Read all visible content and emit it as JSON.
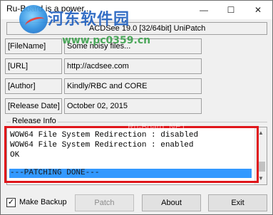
{
  "window": {
    "title": "Ru-Board is a power...",
    "minimize_glyph": "—",
    "maximize_glyph": "☐",
    "close_glyph": "✕"
  },
  "watermark": {
    "cn_text": "河东软件园",
    "url": "www.pc0359.cn",
    "ghost_text": "Ru-Board .NET"
  },
  "product_bar": {
    "text": "ACDSee 19.0 [32/64bit] UniPatch"
  },
  "info_rows": [
    {
      "label": "[FileName]",
      "value": "Some noisy files..."
    },
    {
      "label": "[URL]",
      "value": "http://acdsee.com"
    },
    {
      "label": "[Author]",
      "value": "Kindly/RBC and CORE"
    },
    {
      "label": "[Release Date]",
      "value": "October 02, 2015"
    }
  ],
  "release_info": {
    "label": "Release Info",
    "lines": [
      "WOW64 File System Redirection : disabled",
      "WOW64 File System Redirection : enabled",
      "OK"
    ],
    "selected_line": "---PATCHING DONE---",
    "scroll_up_glyph": "▲",
    "scroll_down_glyph": "▼"
  },
  "footer": {
    "make_backup_label": "Make Backup",
    "make_backup_checked": true,
    "check_glyph": "✓",
    "patch_label": "Patch",
    "about_label": "About",
    "exit_label": "Exit"
  },
  "colors": {
    "selection": "#3399ff",
    "highlight_border": "#e0161b",
    "window_bg": "#f0f0f0"
  }
}
